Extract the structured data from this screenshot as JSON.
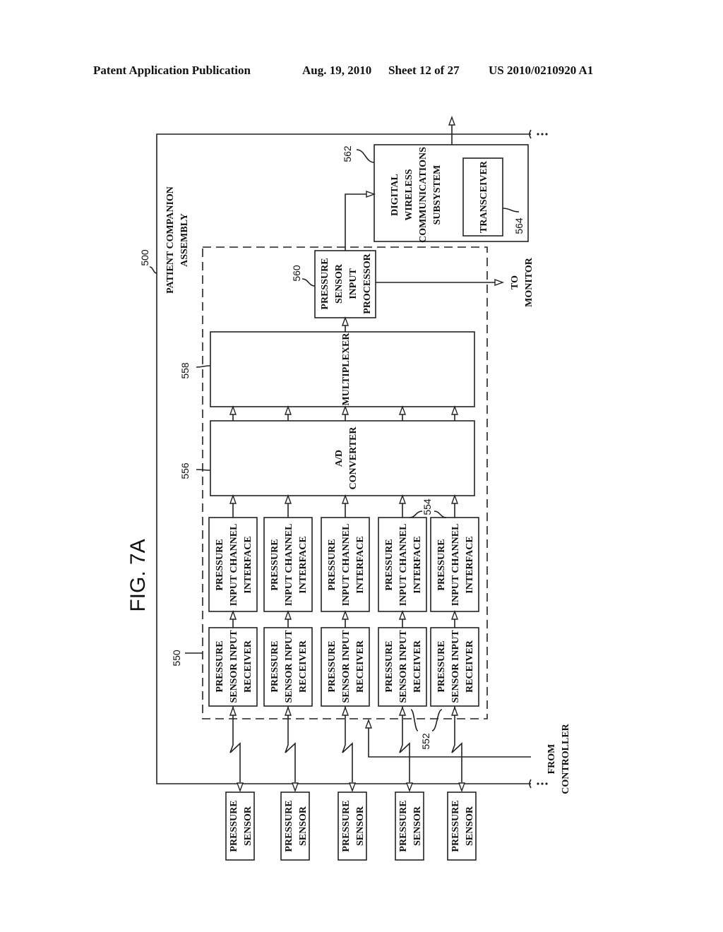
{
  "header": {
    "publication": "Patent Application Publication",
    "date": "Aug. 19, 2010",
    "sheet": "Sheet 12 of 27",
    "number": "US 2010/0210920 A1"
  },
  "figure": {
    "title": "FIG. 7A",
    "assembly_label": [
      "PATIENT COMPANION",
      "ASSEMBLY"
    ],
    "refs": {
      "assembly": "500",
      "receivers": "550",
      "wireless_links": "552",
      "interfaces": "554",
      "ad_converter": "556",
      "multiplexer": "558",
      "processor": "560",
      "wireless_subsystem": "562",
      "transceiver": "564"
    },
    "sensors": [
      [
        "PRESSURE",
        "SENSOR"
      ],
      [
        "PRESSURE",
        "SENSOR"
      ],
      [
        "PRESSURE",
        "SENSOR"
      ],
      [
        "PRESSURE",
        "SENSOR"
      ],
      [
        "PRESSURE",
        "SENSOR"
      ]
    ],
    "receivers": [
      [
        "PRESSURE",
        "SENSOR INPUT",
        "RECEIVER"
      ],
      [
        "PRESSURE",
        "SENSOR INPUT",
        "RECEIVER"
      ],
      [
        "PRESSURE",
        "SENSOR INPUT",
        "RECEIVER"
      ],
      [
        "PRESSURE",
        "SENSOR INPUT",
        "RECEIVER"
      ],
      [
        "PRESSURE",
        "SENSOR INPUT",
        "RECEIVER"
      ]
    ],
    "interfaces": [
      [
        "PRESSURE",
        "INPUT CHANNEL",
        "INTERFACE"
      ],
      [
        "PRESSURE",
        "INPUT CHANNEL",
        "INTERFACE"
      ],
      [
        "PRESSURE",
        "INPUT CHANNEL",
        "INTERFACE"
      ],
      [
        "PRESSURE",
        "INPUT CHANNEL",
        "INTERFACE"
      ],
      [
        "PRESSURE",
        "INPUT CHANNEL",
        "INTERFACE"
      ]
    ],
    "ad_converter": [
      "A/D",
      "CONVERTER"
    ],
    "multiplexer": [
      "MULTIPLEXER"
    ],
    "processor": [
      "PRESSURE",
      "SENSOR",
      "INPUT",
      "PROCESSOR"
    ],
    "wireless_subsystem": [
      "DIGITAL",
      "WIRELESS",
      "COMMUNICATIONS",
      "SUBSYSTEM"
    ],
    "transceiver": [
      "TRANSCEIVER"
    ],
    "to_monitor": [
      "TO",
      "MONITOR"
    ],
    "from_controller": [
      "FROM",
      "CONTROLLER"
    ],
    "ellipsis": "..."
  }
}
